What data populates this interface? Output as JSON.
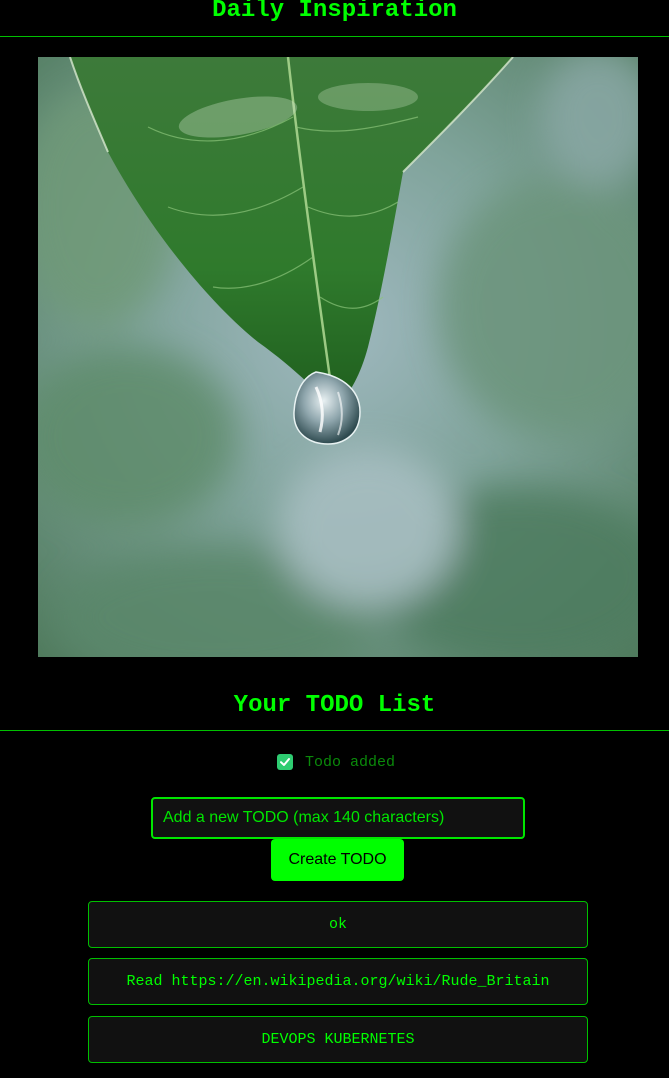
{
  "header": {
    "title": "Daily Inspiration"
  },
  "photo": {
    "description_icon": "leaf-water-drop-photo"
  },
  "todo": {
    "title": "Your TODO List",
    "status_text": "Todo added",
    "status_checked": true,
    "input_placeholder": "Add a new TODO (max 140 characters)",
    "input_value": "",
    "create_label": "Create TODO",
    "items": [
      {
        "text": "ok"
      },
      {
        "text": "Read https://en.wikipedia.org/wiki/Rude_Britain"
      },
      {
        "text": "DEVOPS KUBERNETES"
      }
    ]
  },
  "colors": {
    "background": "#000000",
    "accent": "#00ff00",
    "item_background": "#111111",
    "check": "#2ecc71"
  }
}
